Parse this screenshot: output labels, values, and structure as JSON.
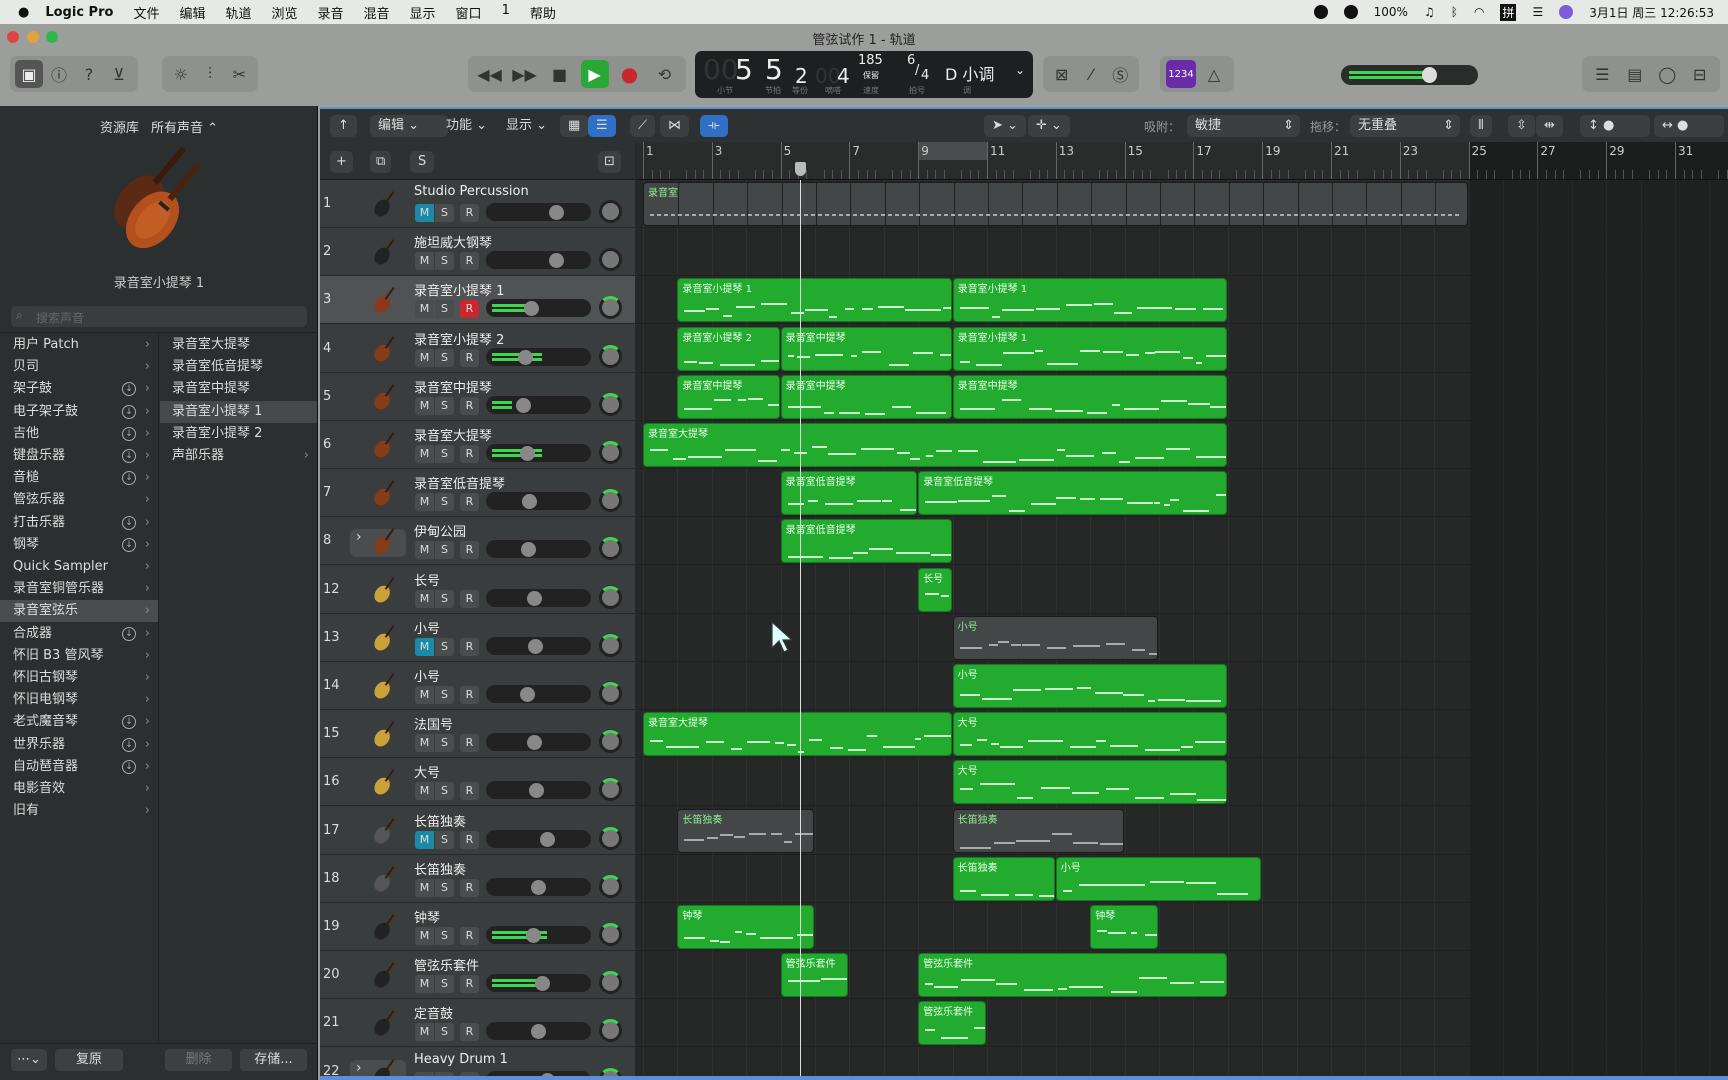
{
  "menubar": {
    "app": "Logic Pro",
    "items": [
      "文件",
      "编辑",
      "轨道",
      "浏览",
      "录音",
      "混音",
      "显示",
      "窗口",
      "1",
      "帮助"
    ],
    "battery": "100%",
    "input": "拼",
    "datetime": "3月1日 周三  12:26:53"
  },
  "window": {
    "title": "管弦试作 1 - 轨道"
  },
  "lcd": {
    "bar": "5",
    "bar_dim": "00",
    "beat": "5",
    "division": "2",
    "tick": "4",
    "tick_dim": "00",
    "tempo": "185",
    "tempo_mode": "保留",
    "sig_num": "6",
    "sig_den": "4",
    "key": "D 小调",
    "labels": {
      "bar": "小节",
      "beat": "节拍",
      "division": "等份",
      "tick": "嘀嗒",
      "tempo": "速度",
      "sig": "拍号",
      "key": "调"
    }
  },
  "count_in": "1234",
  "master_volume": 0.72,
  "library": {
    "title": "资源库",
    "filter": "所有声音 ⌃",
    "patch_name": "录音室小提琴 1",
    "search_placeholder": "搜索声音",
    "categories": [
      {
        "label": "用户 Patch",
        "dl": false
      },
      {
        "label": "贝司",
        "dl": false
      },
      {
        "label": "架子鼓",
        "dl": true
      },
      {
        "label": "电子架子鼓",
        "dl": true
      },
      {
        "label": "吉他",
        "dl": true
      },
      {
        "label": "键盘乐器",
        "dl": true
      },
      {
        "label": "音槌",
        "dl": true
      },
      {
        "label": "管弦乐器",
        "dl": false
      },
      {
        "label": "打击乐器",
        "dl": true
      },
      {
        "label": "钢琴",
        "dl": true
      },
      {
        "label": "Quick Sampler",
        "dl": false
      },
      {
        "label": "录音室铜管乐器",
        "dl": false
      },
      {
        "label": "录音室弦乐",
        "dl": false,
        "selected": true
      },
      {
        "label": "合成器",
        "dl": true
      },
      {
        "label": "怀旧 B3 管风琴",
        "dl": false
      },
      {
        "label": "怀旧古钢琴",
        "dl": false
      },
      {
        "label": "怀旧电钢琴",
        "dl": false
      },
      {
        "label": "老式魔音琴",
        "dl": true
      },
      {
        "label": "世界乐器",
        "dl": true
      },
      {
        "label": "自动琶音器",
        "dl": true
      },
      {
        "label": "电影音效",
        "dl": false
      },
      {
        "label": "旧有",
        "dl": false
      }
    ],
    "patches": [
      {
        "label": "录音室大提琴"
      },
      {
        "label": "录音室低音提琴"
      },
      {
        "label": "录音室中提琴"
      },
      {
        "label": "录音室小提琴 1",
        "selected": true
      },
      {
        "label": "录音室小提琴 2"
      },
      {
        "label": "声部乐器",
        "arrow": true
      }
    ],
    "revert": "复原",
    "delete": "删除",
    "save": "存储..."
  },
  "toolbar": {
    "edit": "编辑",
    "functions": "功能",
    "view": "显示",
    "snap_label": "吸附：",
    "snap_value": "敏捷",
    "drag_label": "拖移：",
    "drag_value": "无重叠"
  },
  "track_header_buttons": {
    "solo": "S"
  },
  "ruler": {
    "labels": [
      "1",
      "3",
      "5",
      "7",
      "9",
      "11",
      "13",
      "15",
      "17",
      "19",
      "21",
      "23",
      "25",
      "27",
      "29",
      "31"
    ],
    "cycle": [
      9,
      11
    ],
    "project_end": 25,
    "playhead_bar": 5.55
  },
  "colors": {
    "region": "#22ab2e",
    "muted_region": "#444747",
    "meter": "#3ed64e",
    "mute_on": "#1b8aa6",
    "record_on": "#c9262d",
    "selection": "#5b8fd6"
  },
  "tracks": [
    {
      "num": "1",
      "name": "Studio Percussion",
      "icon": "percussion-icon",
      "mute": true,
      "rec": false,
      "fader": 0.7,
      "meter": 0,
      "regions": [
        {
          "label": "录音室",
          "start": 1,
          "end": 25,
          "muted": true,
          "seg": true
        }
      ]
    },
    {
      "num": "2",
      "name": "施坦威大钢琴",
      "icon": "grand-piano-icon",
      "mute": false,
      "rec": false,
      "fader": 0.7,
      "meter": 0,
      "regions": []
    },
    {
      "num": "3",
      "name": "录音室小提琴 1",
      "icon": "violin-icon",
      "mute": false,
      "rec": true,
      "fader": 0.42,
      "meter": 0.45,
      "selected": true,
      "regions": [
        {
          "label": "录音室小提琴 1",
          "start": 2,
          "end": 10
        },
        {
          "label": "录音室小提琴 1",
          "start": 10,
          "end": 18
        }
      ]
    },
    {
      "num": "4",
      "name": "录音室小提琴 2",
      "icon": "violin-icon",
      "mute": false,
      "rec": false,
      "fader": 0.35,
      "meter": 0.5,
      "regions": [
        {
          "label": "录音室小提琴 2",
          "start": 2,
          "end": 5
        },
        {
          "label": "录音室中提琴",
          "start": 5,
          "end": 10
        },
        {
          "label": "录音室小提琴 1",
          "start": 10,
          "end": 18
        }
      ]
    },
    {
      "num": "5",
      "name": "录音室中提琴",
      "icon": "viola-icon",
      "mute": false,
      "rec": false,
      "fader": 0.33,
      "meter": 0.2,
      "regions": [
        {
          "label": "录音室中提琴",
          "start": 2,
          "end": 5
        },
        {
          "label": "录音室中提琴",
          "start": 5,
          "end": 10
        },
        {
          "label": "录音室中提琴",
          "start": 10,
          "end": 18
        }
      ]
    },
    {
      "num": "6",
      "name": "录音室大提琴",
      "icon": "cello-icon",
      "mute": false,
      "rec": false,
      "fader": 0.38,
      "meter": 0.5,
      "regions": [
        {
          "label": "录音室大提琴",
          "start": 1,
          "end": 18
        }
      ]
    },
    {
      "num": "7",
      "name": "录音室低音提琴",
      "icon": "double-bass-icon",
      "mute": false,
      "rec": false,
      "fader": 0.4,
      "meter": 0,
      "regions": [
        {
          "label": "录音室低音提琴",
          "start": 5,
          "end": 9
        },
        {
          "label": "录音室低音提琴",
          "start": 9,
          "end": 18
        }
      ]
    },
    {
      "num": "8",
      "name": "伊甸公园",
      "icon": "strings-ensemble-icon",
      "mute": false,
      "rec": false,
      "fader": 0.39,
      "meter": 0,
      "folder": true,
      "regions": [
        {
          "label": "录音室低音提琴",
          "start": 5,
          "end": 10
        }
      ]
    },
    {
      "num": "12",
      "name": "长号",
      "icon": "trombone-icon",
      "mute": false,
      "rec": false,
      "fader": 0.45,
      "meter": 0,
      "regions": [
        {
          "label": "长号",
          "start": 9,
          "end": 10
        }
      ]
    },
    {
      "num": "13",
      "name": "小号",
      "icon": "trumpet-icon",
      "mute": true,
      "rec": false,
      "fader": 0.47,
      "meter": 0,
      "regions": [
        {
          "label": "小号",
          "start": 10,
          "end": 16,
          "muted": true
        }
      ]
    },
    {
      "num": "14",
      "name": "小号",
      "icon": "trumpet-icon",
      "mute": false,
      "rec": false,
      "fader": 0.38,
      "meter": 0,
      "regions": [
        {
          "label": "小号",
          "start": 10,
          "end": 18
        }
      ]
    },
    {
      "num": "15",
      "name": "法国号",
      "icon": "french-horn-icon",
      "mute": false,
      "rec": false,
      "fader": 0.45,
      "meter": 0,
      "regions": [
        {
          "label": "录音室大提琴",
          "start": 1,
          "end": 10
        },
        {
          "label": "大号",
          "start": 10,
          "end": 18
        }
      ]
    },
    {
      "num": "16",
      "name": "大号",
      "icon": "tuba-icon",
      "mute": false,
      "rec": false,
      "fader": 0.48,
      "meter": 0,
      "regions": [
        {
          "label": "大号",
          "start": 10,
          "end": 18
        }
      ]
    },
    {
      "num": "17",
      "name": "长笛独奏",
      "icon": "flute-icon",
      "mute": true,
      "rec": false,
      "fader": 0.6,
      "meter": 0,
      "regions": [
        {
          "label": "长笛独奏",
          "start": 2,
          "end": 6,
          "muted": true
        },
        {
          "label": "长笛独奏",
          "start": 10,
          "end": 15,
          "muted": true
        }
      ]
    },
    {
      "num": "18",
      "name": "长笛独奏",
      "icon": "flute-icon",
      "mute": false,
      "rec": false,
      "fader": 0.5,
      "meter": 0,
      "regions": [
        {
          "label": "长笛独奏",
          "start": 10,
          "end": 13
        },
        {
          "label": "小号",
          "start": 13,
          "end": 19
        }
      ]
    },
    {
      "num": "19",
      "name": "钟琴",
      "icon": "glockenspiel-icon",
      "mute": false,
      "rec": false,
      "fader": 0.44,
      "meter": 0.55,
      "regions": [
        {
          "label": "钟琴",
          "start": 2,
          "end": 6
        },
        {
          "label": "钟琴",
          "start": 14,
          "end": 16
        }
      ]
    },
    {
      "num": "20",
      "name": "管弦乐套件",
      "icon": "drumsticks-icon",
      "mute": false,
      "rec": false,
      "fader": 0.54,
      "meter": 0.45,
      "regions": [
        {
          "label": "管弦乐套件",
          "start": 5,
          "end": 7
        },
        {
          "label": "管弦乐套件",
          "start": 9,
          "end": 18
        }
      ]
    },
    {
      "num": "21",
      "name": "定音鼓",
      "icon": "timpani-icon",
      "mute": false,
      "rec": false,
      "fader": 0.5,
      "meter": 0,
      "regions": [
        {
          "label": "管弦乐套件",
          "start": 9,
          "end": 11
        }
      ]
    },
    {
      "num": "22",
      "name": "Heavy Drum 1",
      "icon": "drum-kit-icon",
      "mute": false,
      "rec": false,
      "fader": 0.6,
      "meter": 0,
      "folder": true,
      "regions": []
    }
  ]
}
